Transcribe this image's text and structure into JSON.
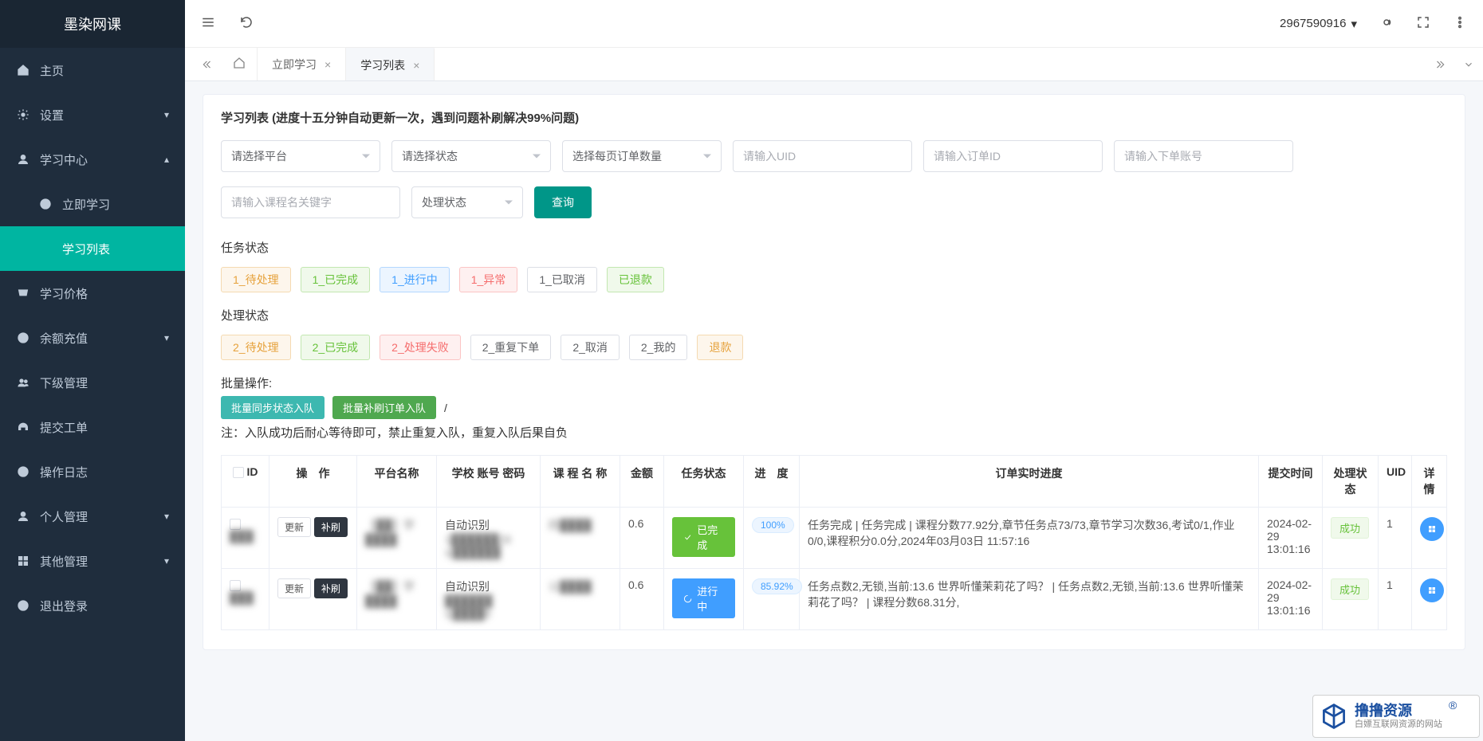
{
  "app": {
    "name": "墨染网课"
  },
  "topbar": {
    "user_id": "2967590916"
  },
  "sidebar": {
    "items": [
      {
        "icon": "home",
        "label": "主页"
      },
      {
        "icon": "gear",
        "label": "设置",
        "arrow": "down"
      },
      {
        "icon": "user",
        "label": "学习中心",
        "arrow": "up"
      },
      {
        "icon": "plus-circle",
        "label": "立即学习",
        "sub": true
      },
      {
        "icon": "",
        "label": "学习列表",
        "sub": true,
        "active": true
      },
      {
        "icon": "cart",
        "label": "学习价格"
      },
      {
        "icon": "yen",
        "label": "余额充值",
        "arrow": "down"
      },
      {
        "icon": "users",
        "label": "下级管理"
      },
      {
        "icon": "headset",
        "label": "提交工单"
      },
      {
        "icon": "yen",
        "label": "操作日志"
      },
      {
        "icon": "user",
        "label": "个人管理",
        "arrow": "down"
      },
      {
        "icon": "grid",
        "label": "其他管理",
        "arrow": "down"
      },
      {
        "icon": "x-circle",
        "label": "退出登录"
      }
    ]
  },
  "tabs": {
    "items": [
      {
        "label": "立即学习",
        "closable": true
      },
      {
        "label": "学习列表",
        "closable": true,
        "active": true
      }
    ]
  },
  "panel": {
    "title": "学习列表 (进度十五分钟自动更新一次，遇到问题补刷解决99%问题)",
    "filters": {
      "platform_placeholder": "请选择平台",
      "status_placeholder": "请选择状态",
      "pagesize_placeholder": "选择每页订单数量",
      "uid_placeholder": "请输入UID",
      "orderid_placeholder": "请输入订单ID",
      "account_placeholder": "请输入下单账号",
      "course_placeholder": "请输入课程名关键字",
      "proc_placeholder": "处理状态",
      "query_btn": "查询"
    },
    "task_status_label": "任务状态",
    "task_status_tags": [
      {
        "text": "1_待处理",
        "cls": "orange"
      },
      {
        "text": "1_已完成",
        "cls": "green"
      },
      {
        "text": "1_进行中",
        "cls": "blue"
      },
      {
        "text": "1_异常",
        "cls": "red"
      },
      {
        "text": "1_已取消",
        "cls": "plain"
      },
      {
        "text": "已退款",
        "cls": "green"
      }
    ],
    "proc_status_label": "处理状态",
    "proc_status_tags": [
      {
        "text": "2_待处理",
        "cls": "orange"
      },
      {
        "text": "2_已完成",
        "cls": "green"
      },
      {
        "text": "2_处理失败",
        "cls": "red"
      },
      {
        "text": "2_重复下单",
        "cls": "plain"
      },
      {
        "text": "2_取消",
        "cls": "plain"
      },
      {
        "text": "2_我的",
        "cls": "plain"
      },
      {
        "text": "退款",
        "cls": "orange"
      }
    ],
    "bulk_label": "批量操作:",
    "bulk_ops": [
      {
        "text": "批量同步状态入队",
        "cls": "teal"
      },
      {
        "text": "批量补刷订单入队",
        "cls": "green2"
      }
    ],
    "bulk_sep": "/",
    "bulk_note": "注：入队成功后耐心等待即可，禁止重复入队，重复入队后果自负"
  },
  "table": {
    "headers": [
      "ID",
      "操　作",
      "平台名称",
      "学校 账号 密码",
      "课 程 名 称",
      "金额",
      "任务状态",
      "进　度",
      "订单实时进度",
      "提交时间",
      "处理状态",
      "UID",
      "详情"
    ],
    "op_update": "更新",
    "op_bu": "补刷",
    "rows": [
      {
        "id": "███",
        "platform": "【██】学████",
        "school": "自动识别\n1██████28\nsj██████",
        "course": "四████",
        "amount": "0.6",
        "task_status": "已完成",
        "task_status_cls": "done",
        "task_status_icon": "check",
        "progress": "100%",
        "detail": "任务完成 | 任务完成 | 课程分数77.92分,章节任务点73/73,章节学习次数36,考试0/1,作业0/0,课程积分0.0分,2024年03月03日 11:57:16",
        "submitted": "2024-02-29 13:01:16",
        "proc": "成功",
        "uid": "1"
      },
      {
        "id": "███",
        "platform": "【██】学████",
        "school": "自动识别\n██████\nsj████6",
        "course": "公████",
        "amount": "0.6",
        "task_status": "进行中",
        "task_status_cls": "doing",
        "task_status_icon": "spinner",
        "progress": "85.92%",
        "detail": "任务点数2,无锁,当前:13.6 世界听懂茉莉花了吗？ | 任务点数2,无锁,当前:13.6 世界听懂茉莉花了吗？ | 课程分数68.31分,",
        "submitted": "2024-02-29 13:01:16",
        "proc": "成功",
        "uid": "1"
      }
    ]
  },
  "watermark": {
    "t1": "撸撸资源",
    "t2": "白嫖互联网资源的网站"
  }
}
